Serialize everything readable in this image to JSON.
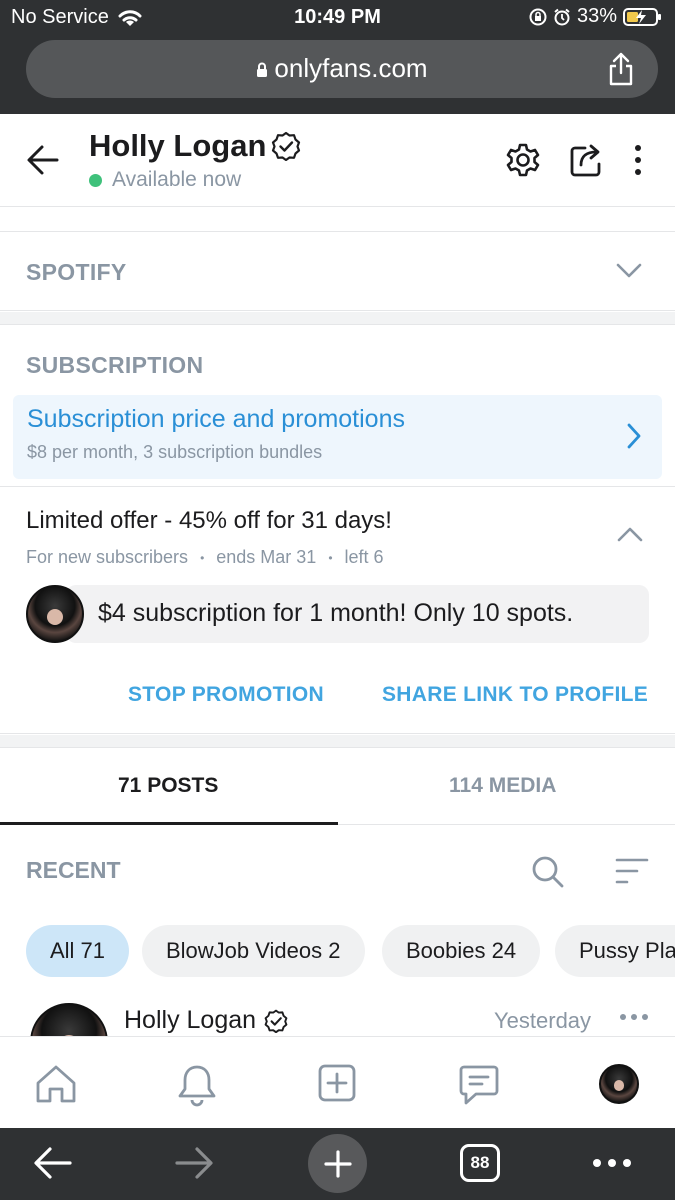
{
  "status_bar": {
    "carrier": "No Service",
    "time": "10:49 PM",
    "battery": "33%"
  },
  "browser": {
    "url": "onlyfans.com",
    "tab_count": "88"
  },
  "profile": {
    "name": "Holly Logan",
    "status": "Available now"
  },
  "spotify": {
    "title": "SPOTIFY"
  },
  "subscription": {
    "title": "SUBSCRIPTION",
    "card_title": "Subscription price and promotions",
    "card_subtitle": "$8 per month, 3 subscription bundles",
    "offer_title": "Limited offer - 45% off for 31 days!",
    "offer_audience": "For new subscribers",
    "offer_ends": "ends Mar 31",
    "offer_left": "left 6",
    "promo_message": "$4 subscription for 1 month! Only 10 spots.",
    "stop_label": "STOP PROMOTION",
    "share_label": "SHARE LINK TO PROFILE"
  },
  "tabs": [
    {
      "label": "71 POSTS",
      "active": true
    },
    {
      "label": "114 MEDIA",
      "active": false
    }
  ],
  "recent": {
    "title": "RECENT",
    "chips": [
      {
        "label": "All 71",
        "active": true
      },
      {
        "label": "BlowJob Videos 2",
        "active": false
      },
      {
        "label": "Boobies 24",
        "active": false
      },
      {
        "label": "Pussy Pla",
        "active": false
      }
    ]
  },
  "post": {
    "author": "Holly Logan",
    "time": "Yesterday"
  },
  "colors": {
    "accent": "#41a5e0",
    "online": "#3fc17b",
    "muted": "#8a96a3"
  }
}
